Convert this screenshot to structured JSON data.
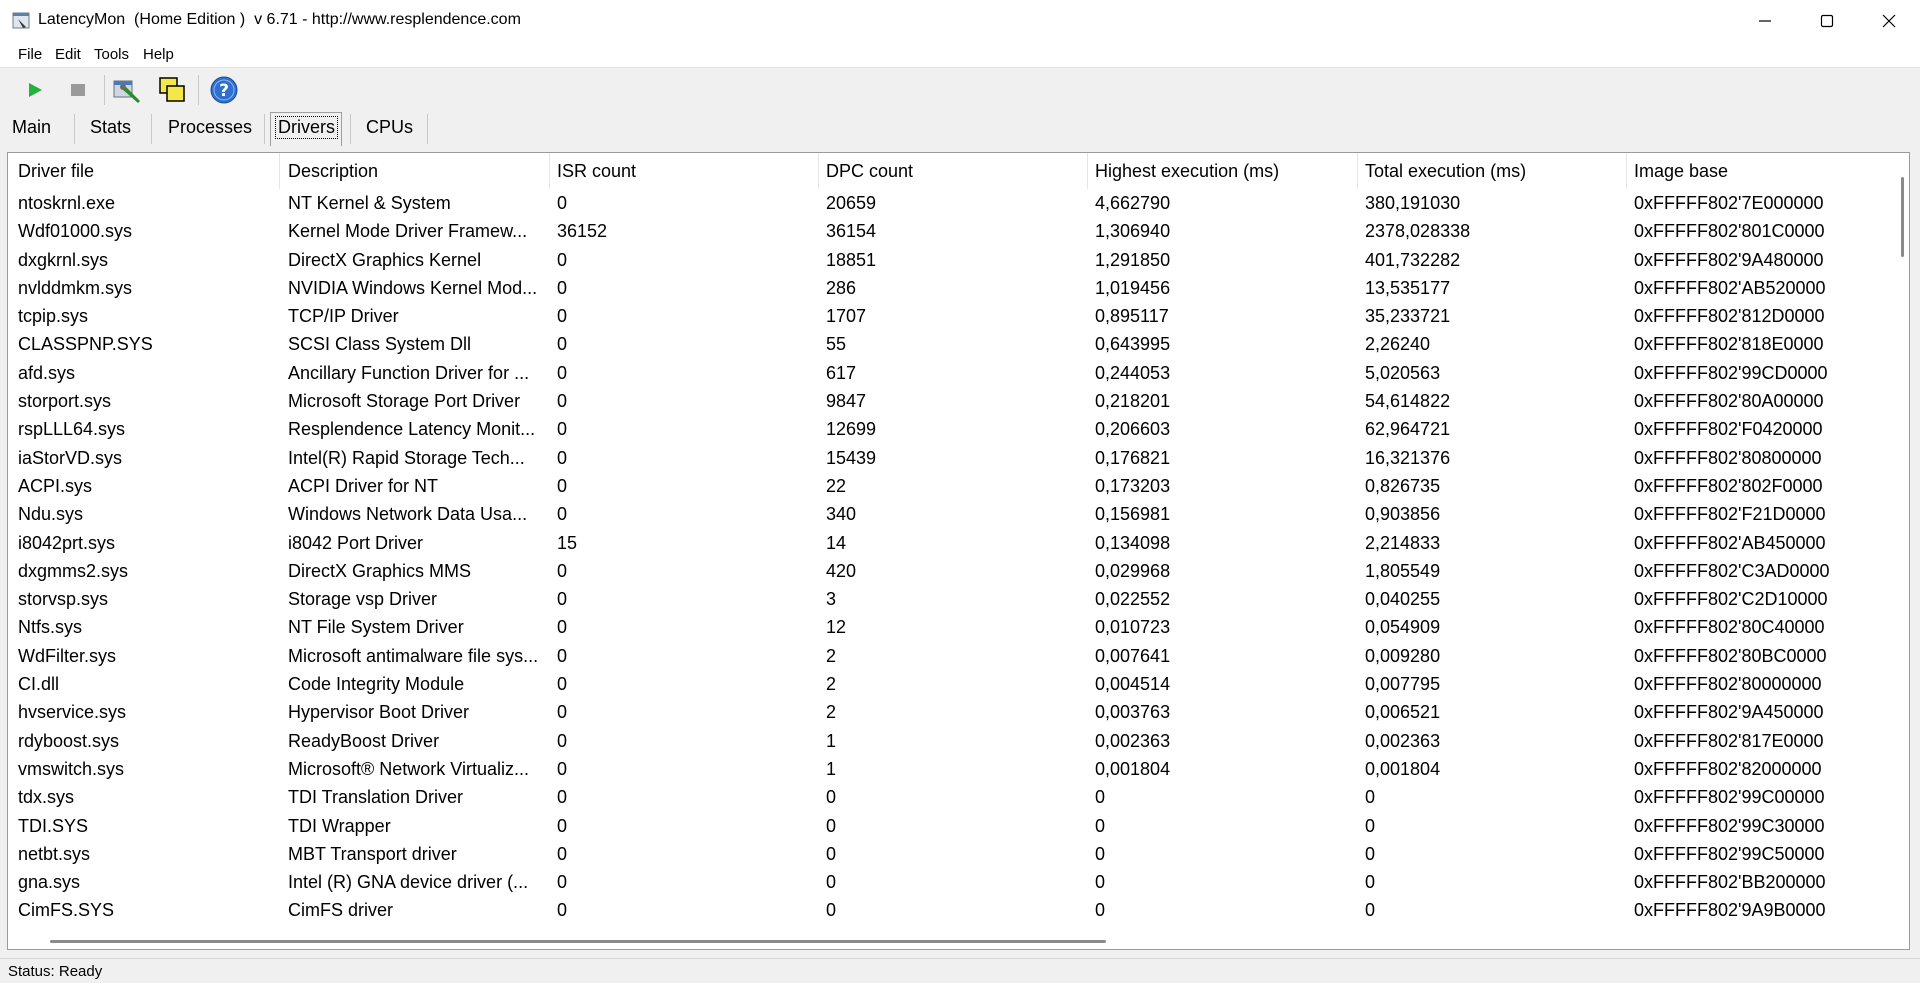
{
  "window": {
    "title": "LatencyMon  (Home Edition )  v 6.71 - http://www.resplendence.com"
  },
  "menu": {
    "items": [
      "File",
      "Edit",
      "Tools",
      "Help"
    ]
  },
  "toolbar": {
    "icons": [
      "play-icon",
      "stop-icon",
      "wrench-icon",
      "windows-icon",
      "help-icon"
    ]
  },
  "tabs": [
    "Main",
    "Stats",
    "Processes",
    "Drivers",
    "CPUs"
  ],
  "active_tab": "Drivers",
  "table": {
    "columns": [
      "Driver file",
      "Description",
      "ISR count",
      "DPC count",
      "Highest execution (ms)",
      "Total execution (ms)",
      "Image base"
    ],
    "rows": [
      [
        "ntoskrnl.exe",
        "NT Kernel & System",
        "0",
        "20659",
        "4,662790",
        "380,191030",
        "0xFFFFF802'7E000000"
      ],
      [
        "Wdf01000.sys",
        "Kernel Mode Driver Framew...",
        "36152",
        "36154",
        "1,306940",
        "2378,028338",
        "0xFFFFF802'801C0000"
      ],
      [
        "dxgkrnl.sys",
        "DirectX Graphics Kernel",
        "0",
        "18851",
        "1,291850",
        "401,732282",
        "0xFFFFF802'9A480000"
      ],
      [
        "nvlddmkm.sys",
        "NVIDIA Windows Kernel Mod...",
        "0",
        "286",
        "1,019456",
        "13,535177",
        "0xFFFFF802'AB520000"
      ],
      [
        "tcpip.sys",
        "TCP/IP Driver",
        "0",
        "1707",
        "0,895117",
        "35,233721",
        "0xFFFFF802'812D0000"
      ],
      [
        "CLASSPNP.SYS",
        "SCSI Class System Dll",
        "0",
        "55",
        "0,643995",
        "2,26240",
        "0xFFFFF802'818E0000"
      ],
      [
        "afd.sys",
        "Ancillary Function Driver for ...",
        "0",
        "617",
        "0,244053",
        "5,020563",
        "0xFFFFF802'99CD0000"
      ],
      [
        "storport.sys",
        "Microsoft Storage Port Driver",
        "0",
        "9847",
        "0,218201",
        "54,614822",
        "0xFFFFF802'80A00000"
      ],
      [
        "rspLLL64.sys",
        "Resplendence Latency Monit...",
        "0",
        "12699",
        "0,206603",
        "62,964721",
        "0xFFFFF802'F0420000"
      ],
      [
        "iaStorVD.sys",
        "Intel(R) Rapid Storage Tech...",
        "0",
        "15439",
        "0,176821",
        "16,321376",
        "0xFFFFF802'80800000"
      ],
      [
        "ACPI.sys",
        "ACPI Driver for NT",
        "0",
        "22",
        "0,173203",
        "0,826735",
        "0xFFFFF802'802F0000"
      ],
      [
        "Ndu.sys",
        "Windows Network Data Usa...",
        "0",
        "340",
        "0,156981",
        "0,903856",
        "0xFFFFF802'F21D0000"
      ],
      [
        "i8042prt.sys",
        "i8042 Port Driver",
        "15",
        "14",
        "0,134098",
        "2,214833",
        "0xFFFFF802'AB450000"
      ],
      [
        "dxgmms2.sys",
        "DirectX Graphics MMS",
        "0",
        "420",
        "0,029968",
        "1,805549",
        "0xFFFFF802'C3AD0000"
      ],
      [
        "storvsp.sys",
        "Storage vsp Driver",
        "0",
        "3",
        "0,022552",
        "0,040255",
        "0xFFFFF802'C2D10000"
      ],
      [
        "Ntfs.sys",
        "NT File System Driver",
        "0",
        "12",
        "0,010723",
        "0,054909",
        "0xFFFFF802'80C40000"
      ],
      [
        "WdFilter.sys",
        "Microsoft antimalware file sys...",
        "0",
        "2",
        "0,007641",
        "0,009280",
        "0xFFFFF802'80BC0000"
      ],
      [
        "CI.dll",
        "Code Integrity Module",
        "0",
        "2",
        "0,004514",
        "0,007795",
        "0xFFFFF802'80000000"
      ],
      [
        "hvservice.sys",
        "Hypervisor Boot Driver",
        "0",
        "2",
        "0,003763",
        "0,006521",
        "0xFFFFF802'9A450000"
      ],
      [
        "rdyboost.sys",
        "ReadyBoost Driver",
        "0",
        "1",
        "0,002363",
        "0,002363",
        "0xFFFFF802'817E0000"
      ],
      [
        "vmswitch.sys",
        "Microsoft® Network Virtualiz...",
        "0",
        "1",
        "0,001804",
        "0,001804",
        "0xFFFFF802'82000000"
      ],
      [
        "tdx.sys",
        "TDI Translation Driver",
        "0",
        "0",
        "0",
        "0",
        "0xFFFFF802'99C00000"
      ],
      [
        "TDI.SYS",
        "TDI Wrapper",
        "0",
        "0",
        "0",
        "0",
        "0xFFFFF802'99C30000"
      ],
      [
        "netbt.sys",
        "MBT Transport driver",
        "0",
        "0",
        "0",
        "0",
        "0xFFFFF802'99C50000"
      ],
      [
        "gna.sys",
        "Intel (R) GNA device driver (...",
        "0",
        "0",
        "0",
        "0",
        "0xFFFFF802'BB200000"
      ],
      [
        "CimFS.SYS",
        "CimFS driver",
        "0",
        "0",
        "0",
        "0",
        "0xFFFFF802'9A9B0000"
      ]
    ]
  },
  "status": {
    "text": "Status: Ready"
  }
}
